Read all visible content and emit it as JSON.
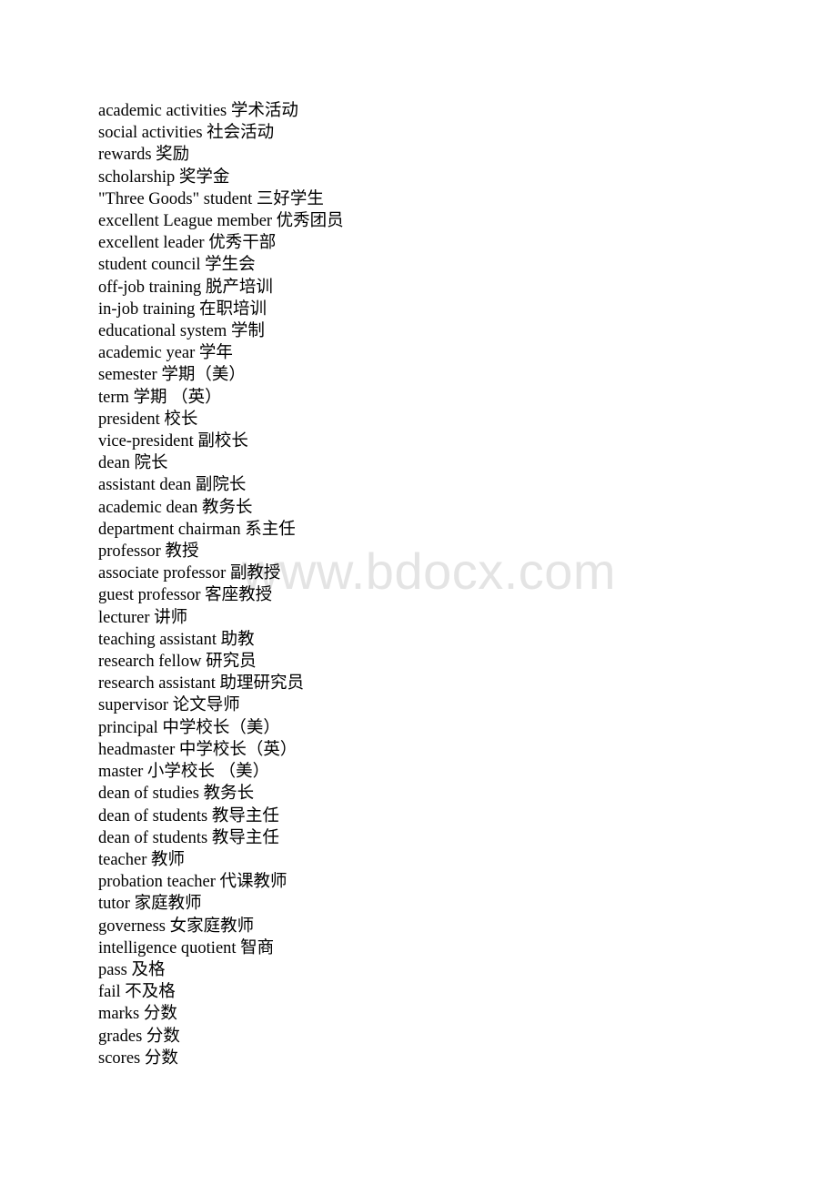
{
  "document": {
    "watermark": "www.bdocx.com",
    "glossary_entries": [
      "academic activities 学术活动",
      "social activities 社会活动",
      "rewards 奖励",
      "scholarship 奖学金",
      "\"Three Goods\" student 三好学生",
      "excellent League member 优秀团员",
      "excellent leader 优秀干部",
      "student council 学生会",
      "off-job training 脱产培训",
      "in-job training 在职培训",
      "educational system 学制",
      "academic year 学年",
      "semester 学期（美）",
      "term 学期 （英）",
      "president 校长",
      "vice-president 副校长",
      "dean 院长",
      "assistant dean 副院长",
      "academic dean 教务长",
      "department chairman 系主任",
      "professor 教授",
      "associate professor 副教授",
      "guest professor 客座教授",
      "lecturer 讲师",
      "teaching assistant 助教",
      "research fellow 研究员",
      "research assistant 助理研究员",
      "supervisor 论文导师",
      "principal 中学校长（美）",
      "headmaster 中学校长（英）",
      "master 小学校长 （美）",
      "dean of studies 教务长",
      "dean of students 教导主任",
      "dean of students 教导主任",
      "teacher 教师",
      "probation teacher 代课教师",
      "tutor 家庭教师",
      "governess 女家庭教师",
      "intelligence quotient 智商",
      "pass 及格",
      "fail 不及格",
      "marks 分数",
      "grades 分数",
      "scores 分数"
    ]
  }
}
